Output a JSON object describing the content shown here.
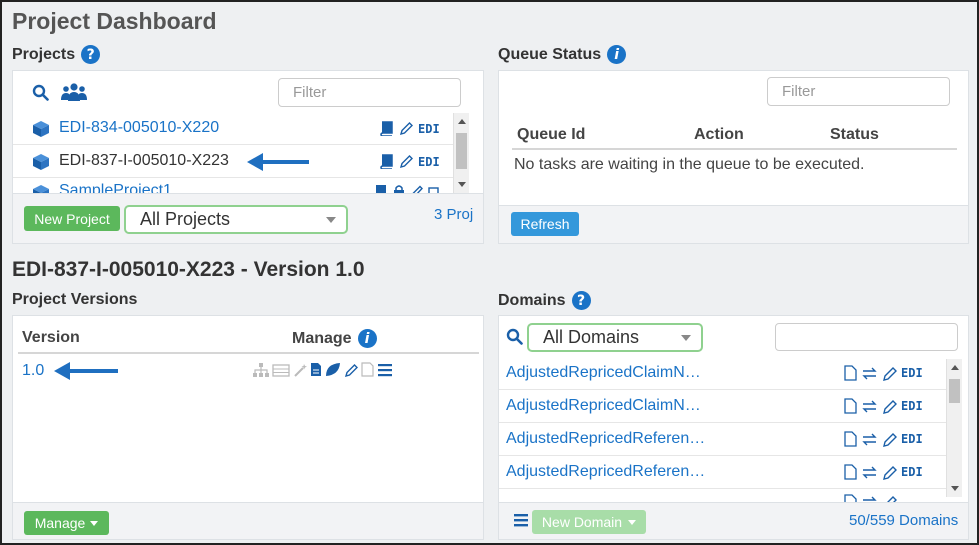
{
  "page": {
    "title": "Project Dashboard"
  },
  "projects": {
    "title": "Projects",
    "filter_placeholder": "Filter",
    "items": [
      {
        "name": "EDI-834-005010-X220"
      },
      {
        "name": "EDI-837-I-005010-X223"
      },
      {
        "name": "SampleProject1"
      }
    ],
    "edi_label": "EDI",
    "new_project_label": "New Project",
    "scope_selected": "All Projects",
    "count_label": "3 Proj"
  },
  "queue": {
    "title": "Queue Status",
    "filter_placeholder": "Filter",
    "columns": [
      "Queue Id",
      "Action",
      "Status"
    ],
    "empty_message": "No tasks are waiting in the queue to be executed.",
    "refresh_label": "Refresh"
  },
  "project_header": {
    "title": "EDI-837-I-005010-X223 - Version 1.0"
  },
  "versions": {
    "title": "Project Versions",
    "columns": {
      "version": "Version",
      "manage": "Manage"
    },
    "rows": [
      {
        "version": "1.0"
      }
    ],
    "manage_label": "Manage"
  },
  "domains": {
    "title": "Domains",
    "scope_selected": "All Domains",
    "edi_label": "EDI",
    "items": [
      {
        "name": "AdjustedRepricedClaimN…"
      },
      {
        "name": "AdjustedRepricedClaimN…"
      },
      {
        "name": "AdjustedRepricedReferen…"
      },
      {
        "name": "AdjustedRepricedReferen…"
      }
    ],
    "new_domain_label": "New Domain",
    "count_label": "50/559 Domains"
  },
  "colors": {
    "accent": "#1a73c7",
    "green": "#5cb85c",
    "arrow": "#1f6fc0"
  }
}
